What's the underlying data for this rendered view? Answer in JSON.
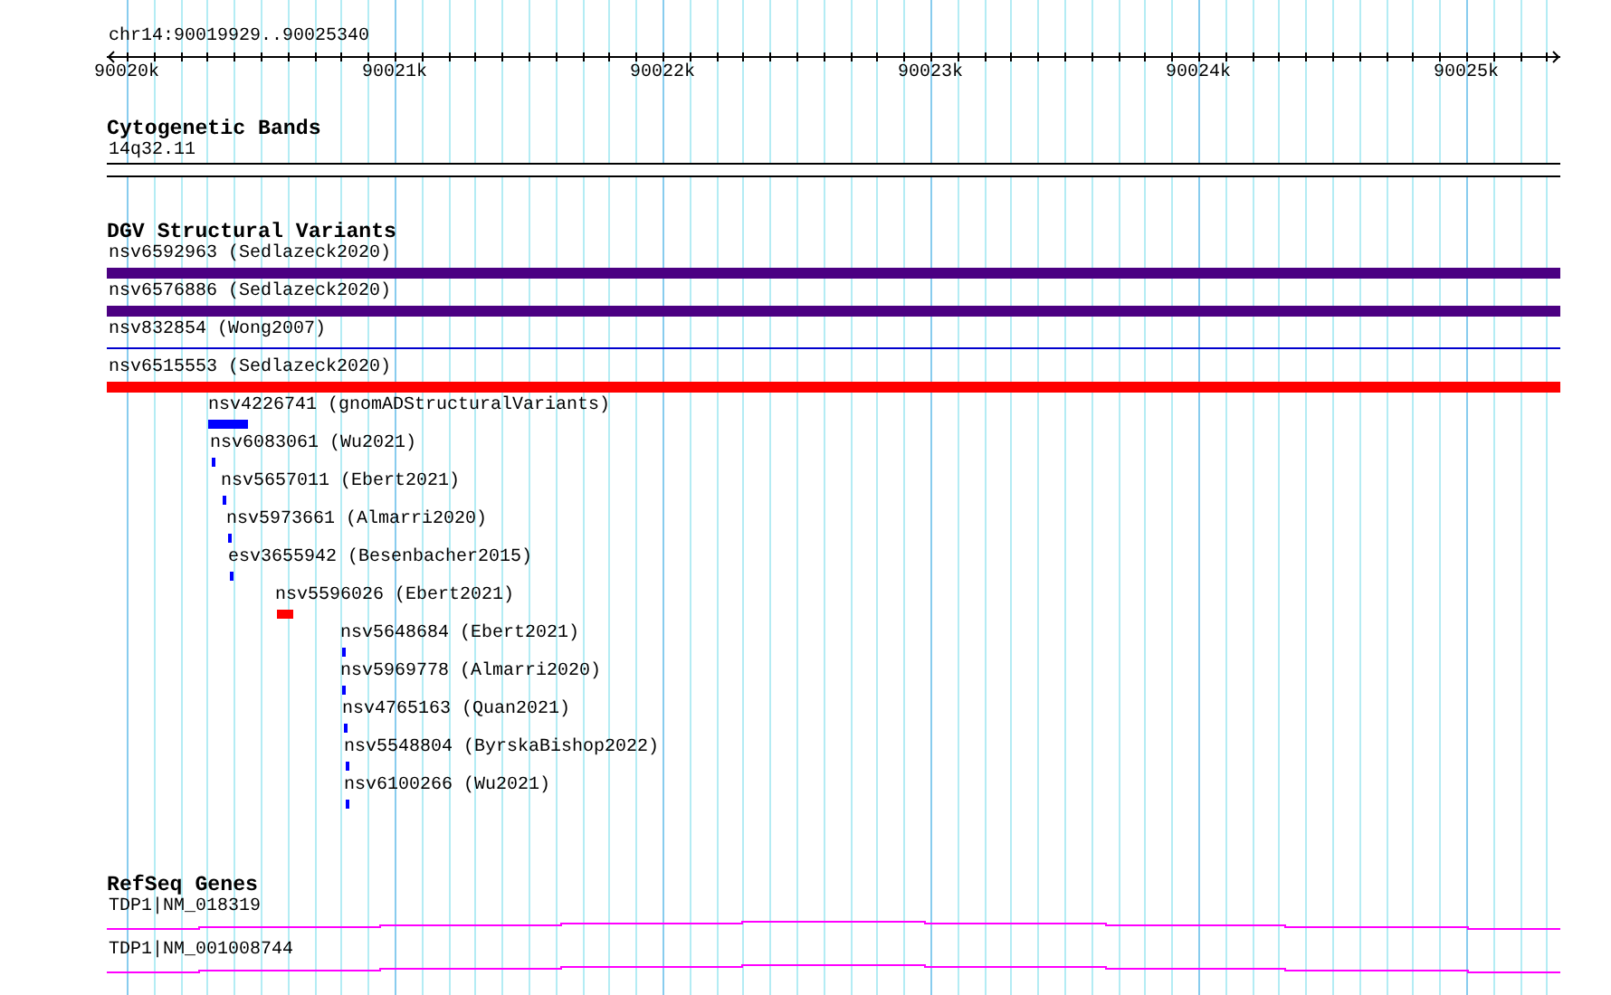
{
  "locus": "chr14:90019929..90025340",
  "ruler": {
    "ticks": [
      "90020k",
      "90021k",
      "90022k",
      "90023k",
      "90024k",
      "90025k"
    ]
  },
  "tracks": [
    {
      "kind": "cytoband",
      "title": "Cytogenetic Bands",
      "features": [
        {
          "label": "14q32.11"
        }
      ]
    },
    {
      "kind": "variants",
      "title": "DGV Structural Variants",
      "features": [
        {
          "label": "nsv6592963 (Sedlazeck2020)",
          "kind": "bar",
          "color": "#4b0082"
        },
        {
          "label": "nsv6576886 (Sedlazeck2020)",
          "kind": "bar",
          "color": "#4b0082"
        },
        {
          "label": "nsv832854 (Wong2007)",
          "kind": "line",
          "color": "#0000cd"
        },
        {
          "label": "nsv6515553 (Sedlazeck2020)",
          "kind": "bar",
          "color": "#ff0000"
        },
        {
          "label": "nsv4226741 (gnomADStructuralVariants)",
          "kind": "bar",
          "color": "#0000ff"
        },
        {
          "label": "nsv6083061 (Wu2021)",
          "kind": "bar",
          "color": "#0000ff"
        },
        {
          "label": "nsv5657011 (Ebert2021)",
          "kind": "bar",
          "color": "#0000ff"
        },
        {
          "label": "nsv5973661 (Almarri2020)",
          "kind": "bar",
          "color": "#0000ff"
        },
        {
          "label": "esv3655942 (Besenbacher2015)",
          "kind": "bar",
          "color": "#0000ff"
        },
        {
          "label": "nsv5596026 (Ebert2021)",
          "kind": "bar",
          "color": "#ff0000"
        },
        {
          "label": "nsv5648684 (Ebert2021)",
          "kind": "bar",
          "color": "#0000ff"
        },
        {
          "label": "nsv5969778 (Almarri2020)",
          "kind": "bar",
          "color": "#0000ff"
        },
        {
          "label": "nsv4765163 (Quan2021)",
          "kind": "bar",
          "color": "#0000ff"
        },
        {
          "label": "nsv5548804 (ByrskaBishop2022)",
          "kind": "bar",
          "color": "#0000ff"
        },
        {
          "label": "nsv6100266 (Wu2021)",
          "kind": "bar",
          "color": "#0000ff"
        }
      ]
    },
    {
      "kind": "genes",
      "title": "RefSeq Genes",
      "features": [
        {
          "label": "TDP1|NM_018319"
        },
        {
          "label": "TDP1|NM_001008744"
        }
      ]
    }
  ]
}
